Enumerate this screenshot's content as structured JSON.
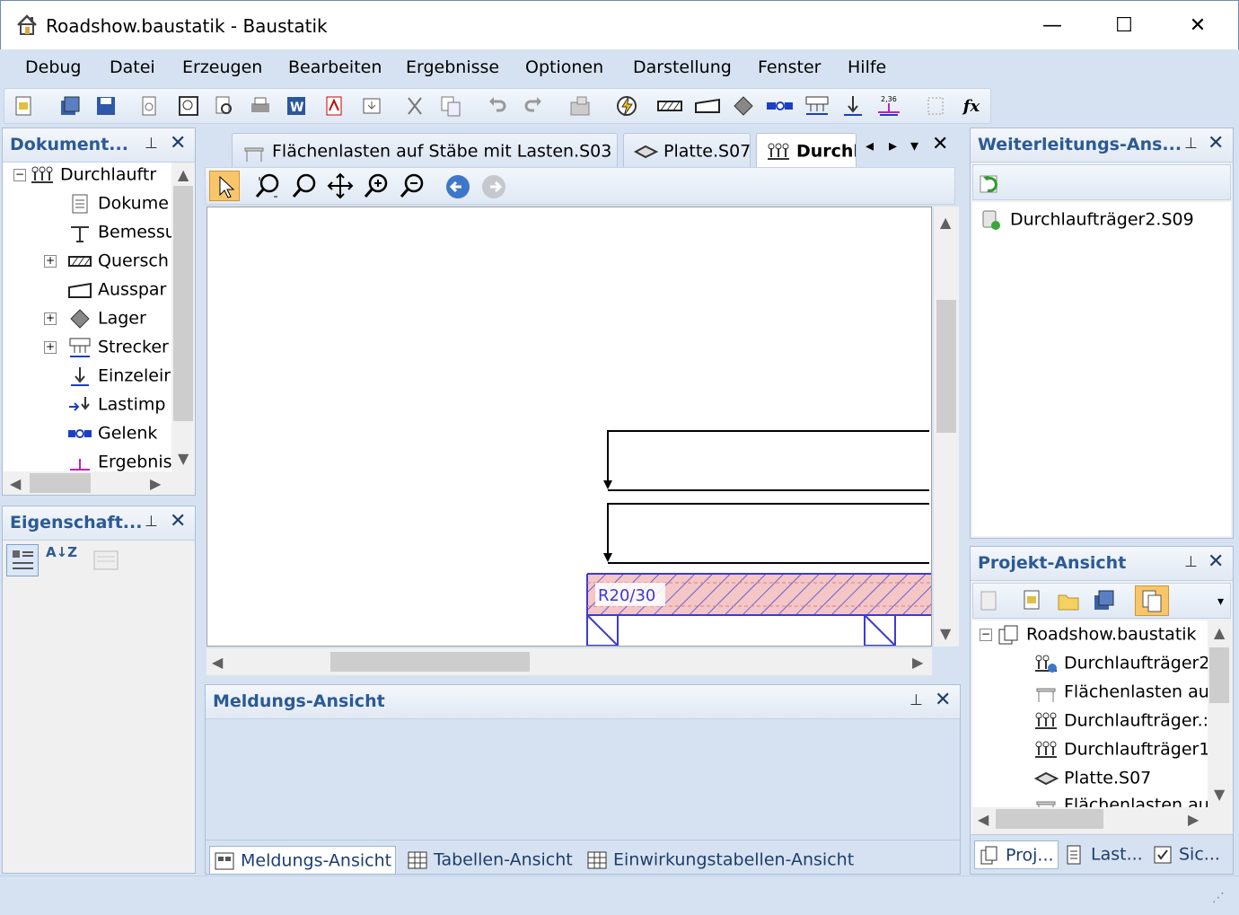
{
  "window": {
    "title": "Roadshow.baustatik - Baustatik",
    "minimize": "—",
    "maximize": "☐",
    "close": "✕"
  },
  "menu": [
    "Debug",
    "Datei",
    "Erzeugen",
    "Bearbeiten",
    "Ergebnisse",
    "Optionen",
    "Darstellung",
    "Fenster",
    "Hilfe"
  ],
  "toolbar": {
    "fx_label": "fx",
    "results_badge": "2,36"
  },
  "document_panel": {
    "title": "Dokument...",
    "tree": [
      {
        "label": "Durchlauftr",
        "expander": "−"
      },
      {
        "label": "Dokume",
        "expander": ""
      },
      {
        "label": "Bemessu",
        "expander": ""
      },
      {
        "label": "Quersch",
        "expander": "+"
      },
      {
        "label": "Ausspar",
        "expander": ""
      },
      {
        "label": "Lager",
        "expander": "+"
      },
      {
        "label": "Strecker",
        "expander": "+"
      },
      {
        "label": "Einzeleir",
        "expander": ""
      },
      {
        "label": "Lastimp",
        "expander": ""
      },
      {
        "label": "Gelenk",
        "expander": ""
      },
      {
        "label": "Ergebnis",
        "expander": ""
      }
    ]
  },
  "properties_panel": {
    "title": "Eigenschaft...",
    "sort_label": "A↓Z"
  },
  "doc_tabs": [
    {
      "label": "Flächenlasten auf Stäbe mit Lasten.S03",
      "active": false
    },
    {
      "label": "Platte.S07",
      "active": false
    },
    {
      "label": "Durchl",
      "active": true
    }
  ],
  "canvas": {
    "section_label": "R20/30"
  },
  "message_panel": {
    "title": "Meldungs-Ansicht"
  },
  "bottom_tabs": [
    "Meldungs-Ansicht",
    "Tabellen-Ansicht",
    "Einwirkungstabellen-Ansicht"
  ],
  "forward_panel": {
    "title": "Weiterleitungs-Ans...",
    "items": [
      "Durchlaufträger2.S09"
    ]
  },
  "project_panel": {
    "title": "Projekt-Ansicht",
    "root": "Roadshow.baustatik",
    "items": [
      "Durchlaufträger2",
      "Flächenlasten au",
      "Durchlaufträger.:",
      "Durchlaufträger1",
      "Platte.S07",
      "Flächenlasten au"
    ]
  },
  "right_bottom_tabs": [
    "Proj...",
    "Last...",
    "Sic..."
  ],
  "colors": {
    "accent": "#2c5a94",
    "chrome": "#d6e2f1",
    "section_hatch": "#3b3bd6",
    "section_fill": "#f4c6c6"
  }
}
